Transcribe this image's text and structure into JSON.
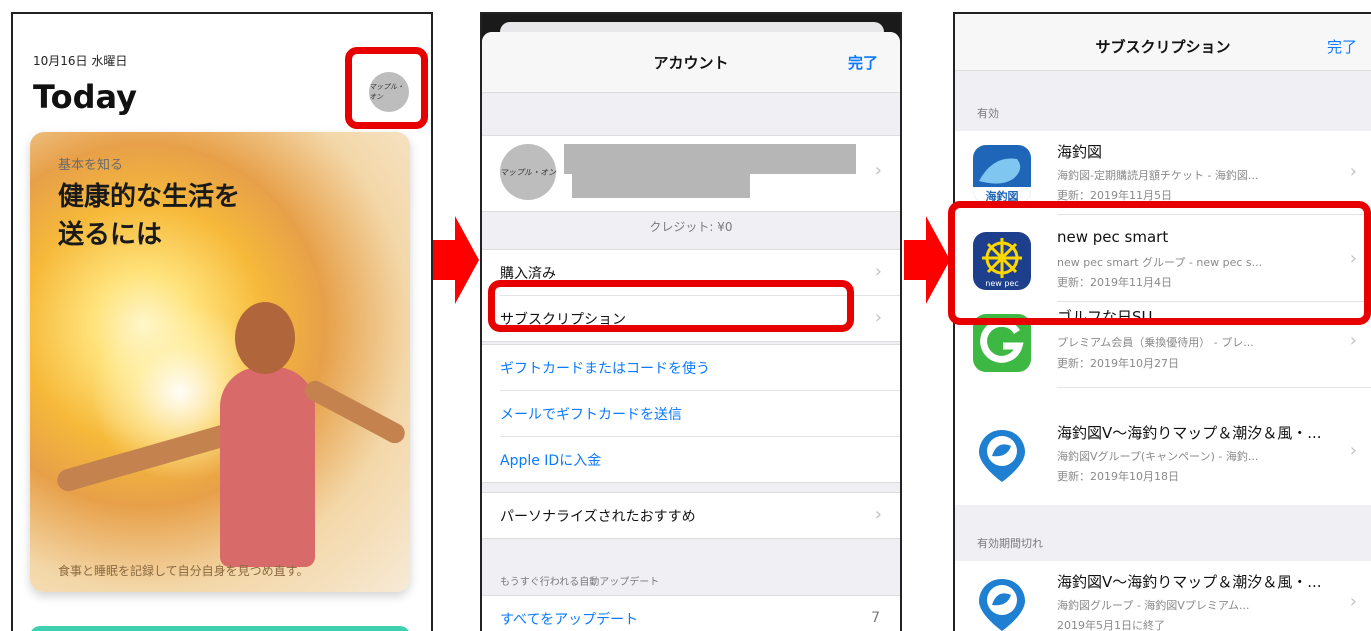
{
  "panel1": {
    "date": "10月16日 水曜日",
    "title": "Today",
    "avatar_text": "マップル・オン",
    "card": {
      "kicker": "基本を知る",
      "headline": "健康的な生活を\n送るには",
      "caption": "食事と睡眠を記録して自分自身を見つめ直す。"
    }
  },
  "panel2": {
    "nav_title": "アカウント",
    "done": "完了",
    "avatar_text": "マップル・オン",
    "credit": "クレジット: ¥0",
    "group1": [
      {
        "label": "購入済み"
      },
      {
        "label": "サブスクリプション"
      }
    ],
    "group2": [
      {
        "label": "ギフトカードまたはコードを使う"
      },
      {
        "label": "メールでギフトカードを送信"
      },
      {
        "label": "Apple IDに入金"
      }
    ],
    "group3": [
      {
        "label": "パーソナライズされたおすすめ"
      }
    ],
    "section_auto_update": "もうすぐ行われる自動アップデート",
    "update_all": {
      "label": "すべてをアップデート",
      "count": "7"
    }
  },
  "panel3": {
    "nav_title": "サブスクリプション",
    "done": "完了",
    "section_active": "有効",
    "section_expired": "有効期間切れ",
    "items": [
      {
        "name": "海釣図",
        "detail": "海釣図-定期購読月額チケット - 海釣図...",
        "date": "更新：2019年11月5日",
        "icon": "kaichouzu-icon"
      },
      {
        "name": "new pec smart",
        "detail": "new pec smart グループ - new pec s...",
        "date": "更新：2019年11月4日",
        "icon": "new-pec-icon"
      },
      {
        "name": "ゴルフな日SU",
        "detail": "プレミアム会員（乗換優待用） - プレ...",
        "date": "更新：2019年10月27日",
        "icon": "golf-g-icon"
      },
      {
        "name": "海釣図V～海釣りマップ＆潮汐＆風・...",
        "detail": "海釣図Vグループ(キャンペーン) - 海釣...",
        "date": "更新：2019年10月18日",
        "icon": "kaichouzu-v-icon"
      }
    ],
    "expired_items": [
      {
        "name": "海釣図V～海釣りマップ＆潮汐＆風・...",
        "detail": "海釣図グループ - 海釣図Vプレミアム...",
        "date": "2019年5月1日に終了",
        "icon": "kaichouzu-v-icon"
      }
    ]
  },
  "colors": {
    "highlight": "#e60000",
    "ios_blue": "#0a7aff",
    "arrow": "#ff0000"
  }
}
